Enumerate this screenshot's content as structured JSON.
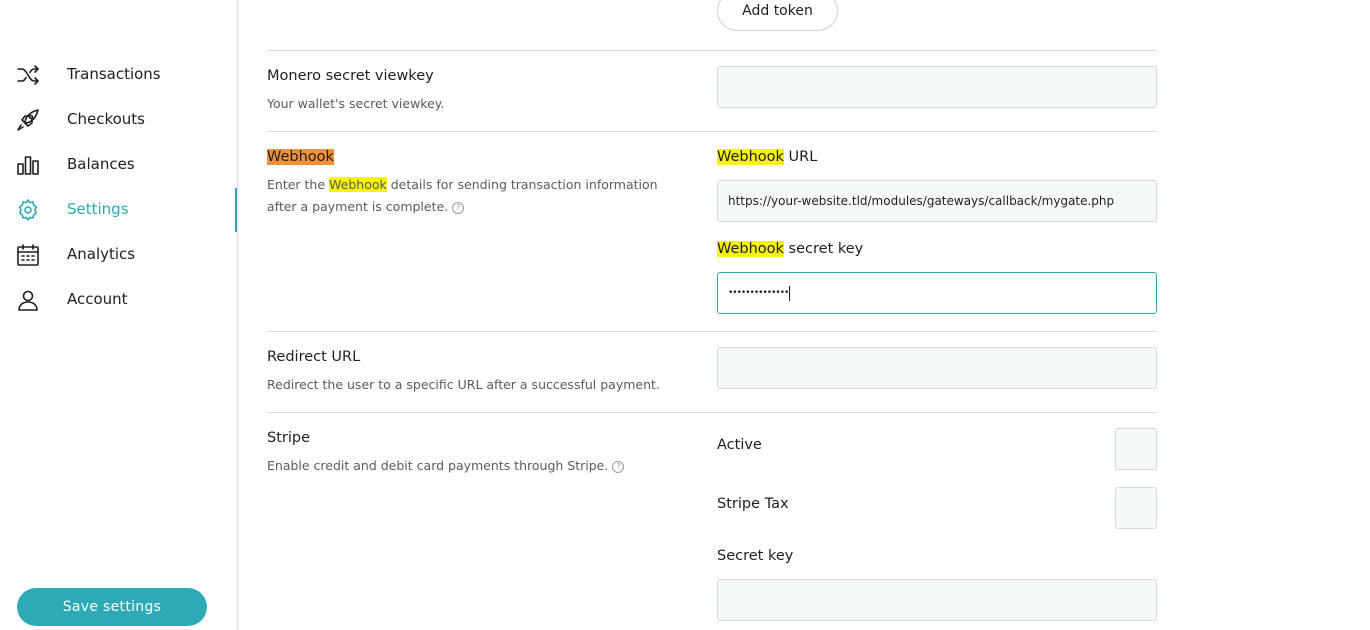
{
  "sidebar": {
    "items": [
      {
        "label": "Transactions",
        "icon": "shuffle-icon"
      },
      {
        "label": "Checkouts",
        "icon": "rocket-icon"
      },
      {
        "label": "Balances",
        "icon": "bar-chart-icon"
      },
      {
        "label": "Settings",
        "icon": "gear-icon",
        "active": true
      },
      {
        "label": "Analytics",
        "icon": "calendar-icon"
      },
      {
        "label": "Account",
        "icon": "user-icon"
      }
    ],
    "save_label": "Save settings"
  },
  "colors": {
    "accent": "#2eaab6",
    "highlight_yellow": "#f5f50a",
    "highlight_orange": "#f0903a"
  },
  "tokens": {
    "add_token_label": "Add token"
  },
  "monero": {
    "title": "Monero secret viewkey",
    "desc": "Your wallet's secret viewkey.",
    "value": ""
  },
  "webhook": {
    "title": "Webhook",
    "desc_before": "Enter the ",
    "desc_highlight": "Webhook",
    "desc_after": " details for sending transaction information after a payment is complete.",
    "url_label_highlight": "Webhook",
    "url_label_rest": " URL",
    "url_value": "https://your-website.tld/modules/gateways/callback/mygate.php",
    "secret_label_highlight": "Webhook",
    "secret_label_rest": " secret key",
    "secret_value": "••••••••••••••"
  },
  "redirect": {
    "title": "Redirect URL",
    "desc": "Redirect the user to a specific URL after a successful payment.",
    "value": ""
  },
  "stripe": {
    "title": "Stripe",
    "desc": "Enable credit and debit card payments through Stripe.",
    "active_label": "Active",
    "tax_label": "Stripe Tax",
    "secret_label": "Secret key",
    "secret_value": ""
  },
  "help_glyph": "?"
}
